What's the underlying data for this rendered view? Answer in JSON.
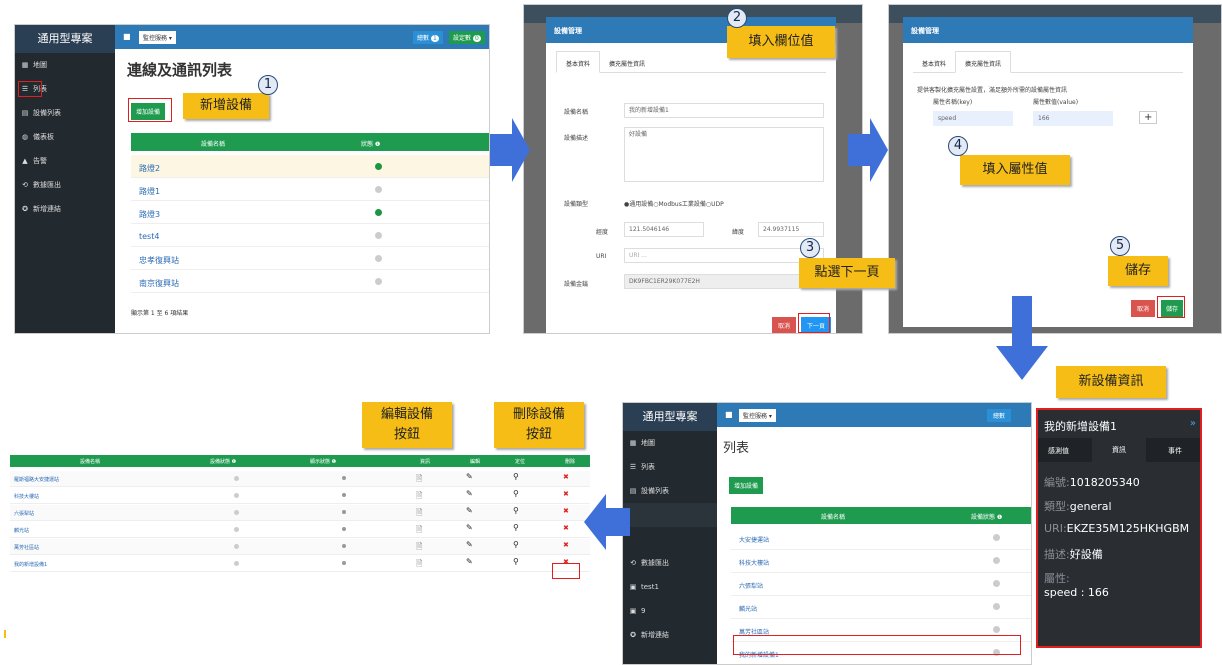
{
  "panel1": {
    "app_title": "通用型專案",
    "menu": [
      "地圖",
      "列表",
      "設備列表",
      "儀表板",
      "告警",
      "數據匯出",
      "新增連結"
    ],
    "dropdown": "監控服務 ▾",
    "badge1": "總數",
    "badge1_count": "1",
    "badge2": "設定數",
    "badge2_count": "0",
    "page_title": "連線及通訊列表",
    "add_button": "增加設備",
    "col1": "設備名稱",
    "col2": "狀態 ❶",
    "rows": [
      {
        "name": "路燈2",
        "status": "green"
      },
      {
        "name": "路燈1",
        "status": "gray"
      },
      {
        "name": "路燈3",
        "status": "green"
      },
      {
        "name": "test4",
        "status": "gray"
      },
      {
        "name": "忠孝復興站",
        "status": "gray"
      },
      {
        "name": "南京復興站",
        "status": "gray"
      }
    ],
    "footer": "顯示第 1 至 6 項結果"
  },
  "panel2": {
    "title": "設備管理",
    "tab1": "基本資料",
    "tab2": "擴充屬性資訊",
    "name_label": "設備名稱",
    "name_value": "我的新增設備1",
    "desc_label": "設備描述",
    "desc_value": "好設備",
    "type_label": "設備類型",
    "type_value": "●通用設備○Modbus工業設備○UDP",
    "lng_label": "經度",
    "lng_value": "121.5046146",
    "lat_label": "緯度",
    "lat_value": "24.9937115",
    "uri_label": "URI",
    "uri_placeholder": "URI ...",
    "key_label": "設備金鑰",
    "key_value": "DK9FBC1ER29K077E2H",
    "cancel": "取消",
    "next": "下一頁"
  },
  "panel3": {
    "title": "設備管理",
    "tab1": "基本資料",
    "tab2": "擴充屬性資訊",
    "hint": "提供客製化擴充屬性設置，滿足額外所需的設備屬性資訊",
    "key_col": "屬性名稱(key)",
    "val_col": "屬性數值(value)",
    "key_value": "speed",
    "val_value": "166",
    "plus": "+",
    "cancel": "取消",
    "save": "儲存"
  },
  "panel4": {
    "app_title": "通用型專案",
    "menu": [
      "地圖",
      "列表",
      "設備列表",
      "",
      "",
      "數據匯出",
      "test1",
      "9",
      "新增連結"
    ],
    "dropdown": "監控服務 ▾",
    "badge": "總數",
    "page_title": "列表",
    "add_button": "增加設備",
    "col1": "設備名稱",
    "col2": "設備狀態 ❶",
    "rows": [
      "大安捷運站",
      "科技大樓站",
      "六張犁站",
      "麟光站",
      "萬芳社區站",
      "我的新增設備1"
    ]
  },
  "info_panel": {
    "title": "我的新增設備1",
    "tabs": [
      "感測值",
      "資訊",
      "事件"
    ],
    "lines": [
      {
        "k": "編號:",
        "v": "1018205340"
      },
      {
        "k": "類型:",
        "v": "general"
      },
      {
        "k": "URI:",
        "v": "EKZE35M125HKHGBM"
      },
      {
        "k": "描述:",
        "v": "好設備"
      },
      {
        "k": "屬性:",
        "v": ""
      },
      {
        "k": "",
        "v": "speed : 166"
      }
    ]
  },
  "panel5": {
    "cols": [
      "設備名稱",
      "設備狀態 ❶",
      "顯示狀態 ❶",
      "資訊",
      "編輯",
      "定位",
      "刪除"
    ],
    "rows": [
      "羅斯福路大安捷運站",
      "科技大樓站",
      "六張犁站",
      "麟光站",
      "萬芳社區站",
      "我的新增設備1"
    ],
    "doc_icon": "🗎",
    "edit_icon": "✎",
    "pin_icon": "⚲",
    "del_icon": "✖"
  },
  "callouts": {
    "c1": "新增設備",
    "c2": "填入欄位值",
    "c3": "點選下一頁",
    "c4": "填入屬性值",
    "c5": "儲存",
    "c6": "新設備資訊",
    "c7": "編輯設備\n按鈕",
    "c8": "刪除設備\n按鈕"
  },
  "steps": [
    "1",
    "2",
    "3",
    "4",
    "5"
  ],
  "colors": {
    "green": "#1e9b4f",
    "accent": "#f6bd16",
    "arrow": "#3f6fd8",
    "sidebar": "#22292f",
    "red": "#e02020"
  }
}
